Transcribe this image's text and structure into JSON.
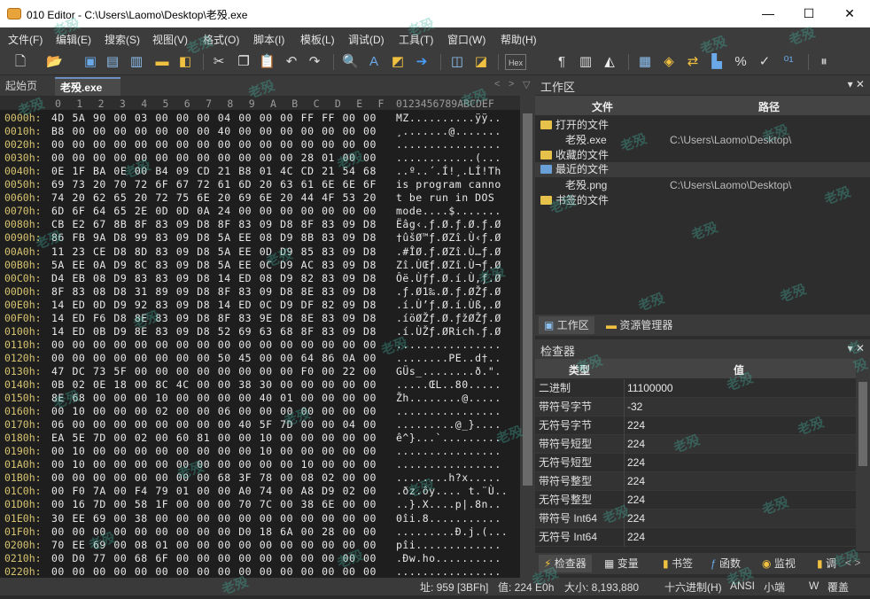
{
  "window": {
    "title": "010 Editor - C:\\Users\\Laomo\\Desktop\\老殁.exe",
    "minimize": "—",
    "maximize": "☐",
    "close": "✕"
  },
  "menu": [
    "文件(F)",
    "编辑(E)",
    "搜索(S)",
    "视图(V)",
    "格式(O)",
    "脚本(I)",
    "模板(L)",
    "调试(D)",
    "工具(T)",
    "窗口(W)",
    "帮助(H)"
  ],
  "tabs": {
    "start": "起始页",
    "file": "老殁.exe",
    "close": "✕"
  },
  "hex": {
    "columns": [
      "0",
      "1",
      "2",
      "3",
      "4",
      "5",
      "6",
      "7",
      "8",
      "9",
      "A",
      "B",
      "C",
      "D",
      "E",
      "F"
    ],
    "ascii_header": "0123456789ABCDEF",
    "rows": [
      {
        "addr": "0000h:",
        "bytes": "4D 5A 90 00 03 00 00 00 04 00 00 00 FF FF 00 00",
        "ascii": "MZ..........ÿÿ.."
      },
      {
        "addr": "0010h:",
        "bytes": "B8 00 00 00 00 00 00 00 40 00 00 00 00 00 00 00",
        "ascii": "¸.......@......."
      },
      {
        "addr": "0020h:",
        "bytes": "00 00 00 00 00 00 00 00 00 00 00 00 00 00 00 00",
        "ascii": "................"
      },
      {
        "addr": "0030h:",
        "bytes": "00 00 00 00 00 00 00 00 00 00 00 00 28 01 00 00",
        "ascii": "............(..."
      },
      {
        "addr": "0040h:",
        "bytes": "0E 1F BA 0E 00 B4 09 CD 21 B8 01 4C CD 21 54 68",
        "ascii": "..º..´.Í!¸.LÍ!Th"
      },
      {
        "addr": "0050h:",
        "bytes": "69 73 20 70 72 6F 67 72 61 6D 20 63 61 6E 6E 6F",
        "ascii": "is program canno"
      },
      {
        "addr": "0060h:",
        "bytes": "74 20 62 65 20 72 75 6E 20 69 6E 20 44 4F 53 20",
        "ascii": "t be run in DOS "
      },
      {
        "addr": "0070h:",
        "bytes": "6D 6F 64 65 2E 0D 0D 0A 24 00 00 00 00 00 00 00",
        "ascii": "mode....$......."
      },
      {
        "addr": "0080h:",
        "bytes": "CB E2 67 8B 8F 83 09 D8 8F 83 09 D8 8F 83 09 D8",
        "ascii": "Ëâg‹.ƒ.Ø.ƒ.Ø.ƒ.Ø"
      },
      {
        "addr": "0090h:",
        "bytes": "86 FB 9A D8 99 83 09 D8 5A EE 08 D9 8B 83 09 D8",
        "ascii": "†ûšØ™ƒ.ØZî.Ù‹ƒ.Ø"
      },
      {
        "addr": "00A0h:",
        "bytes": "11 23 CE D8 8D 83 09 D8 5A EE 0D D9 85 83 09 D8",
        "ascii": ".#ÎØ.ƒ.ØZî.Ù…ƒ.Ø"
      },
      {
        "addr": "00B0h:",
        "bytes": "5A EE 0A D9 8C 83 09 D8 5A EE 0C D9 AC 83 09 D8",
        "ascii": "Zî.ÙŒƒ.ØZî.Ù¬ƒ.Ø"
      },
      {
        "addr": "00C0h:",
        "bytes": "D4 EB 08 D9 83 83 09 D8 14 ED 08 D9 82 83 09 D8",
        "ascii": "Ôë.Ùƒƒ.Ø.í.Ù‚ƒ.Ø"
      },
      {
        "addr": "00D0h:",
        "bytes": "8F 83 08 D8 31 89 09 D8 8F 83 09 D8 8E 83 09 D8",
        "ascii": ".ƒ.Ø1‰.Ø.ƒ.ØŽƒ.Ø"
      },
      {
        "addr": "00E0h:",
        "bytes": "14 ED 0D D9 92 83 09 D8 14 ED 0C D9 DF 82 09 D8",
        "ascii": ".í.Ù’ƒ.Ø.í.Ùß‚.Ø"
      },
      {
        "addr": "00F0h:",
        "bytes": "14 ED F6 D8 8E 83 09 D8 8F 83 9E D8 8E 83 09 D8",
        "ascii": ".íöØŽƒ.Ø.ƒžØŽƒ.Ø"
      },
      {
        "addr": "0100h:",
        "bytes": "14 ED 0B D9 8E 83 09 D8 52 69 63 68 8F 83 09 D8",
        "ascii": ".í.ÙŽƒ.ØRich.ƒ.Ø"
      },
      {
        "addr": "0110h:",
        "bytes": "00 00 00 00 00 00 00 00 00 00 00 00 00 00 00 00",
        "ascii": "................"
      },
      {
        "addr": "0120h:",
        "bytes": "00 00 00 00 00 00 00 00 50 45 00 00 64 86 0A 00",
        "ascii": "........PE..d†.."
      },
      {
        "addr": "0130h:",
        "bytes": "47 DC 73 5F 00 00 00 00 00 00 00 00 F0 00 22 00",
        "ascii": "GÜs_........ð.\"."
      },
      {
        "addr": "0140h:",
        "bytes": "0B 02 0E 18 00 8C 4C 00 00 38 30 00 00 00 00 00",
        "ascii": ".....ŒL..80....."
      },
      {
        "addr": "0150h:",
        "bytes": "8E 68 00 00 00 10 00 00 00 00 40 01 00 00 00 00",
        "ascii": "Žh........@....."
      },
      {
        "addr": "0160h:",
        "bytes": "00 10 00 00 00 02 00 00 06 00 00 00 00 00 00 00",
        "ascii": "................"
      },
      {
        "addr": "0170h:",
        "bytes": "06 00 00 00 00 00 00 00 00 40 5F 7D 00 00 04 00",
        "ascii": ".........@_}...."
      },
      {
        "addr": "0180h:",
        "bytes": "EA 5E 7D 00 02 00 60 81 00 00 10 00 00 00 00 00",
        "ascii": "ê^}...`........."
      },
      {
        "addr": "0190h:",
        "bytes": "00 10 00 00 00 00 00 00 00 00 10 00 00 00 00 00",
        "ascii": "................"
      },
      {
        "addr": "01A0h:",
        "bytes": "00 10 00 00 00 00 00 00 00 00 00 00 10 00 00 00",
        "ascii": "................"
      },
      {
        "addr": "01B0h:",
        "bytes": "00 00 00 00 00 00 00 00 68 3F 78 00 08 02 00 00",
        "ascii": "........h?x....."
      },
      {
        "addr": "01C0h:",
        "bytes": "00 F0 7A 00 F4 79 01 00 00 A0 74 00 A8 D9 02 00",
        "ascii": ".ðz.ôy.... t.¨Ù.."
      },
      {
        "addr": "01D0h:",
        "bytes": "00 16 7D 00 58 1F 00 00 00 70 7C 00 38 6E 00 00",
        "ascii": "..}.X....p|.8n.."
      },
      {
        "addr": "01E0h:",
        "bytes": "30 EE 69 00 38 00 00 00 00 00 00 00 00 00 00 00",
        "ascii": "0îi.8..........."
      },
      {
        "addr": "01F0h:",
        "bytes": "00 00 00 00 00 00 00 00 00 D0 18 6A 00 28 00 00",
        "ascii": ".........Ð.j.(..."
      },
      {
        "addr": "0200h:",
        "bytes": "70 EE 69 00 08 01 00 00 00 00 00 00 00 00 00 00",
        "ascii": "pîi............."
      },
      {
        "addr": "0210h:",
        "bytes": "00 D0 77 00 68 6F 00 00 00 00 00 00 00 00 00 00",
        "ascii": ".Ðw.ho.........."
      },
      {
        "addr": "0220h:",
        "bytes": "00 00 00 00 00 00 00 00 00 00 00 00 00 00 00 00",
        "ascii": "................"
      }
    ]
  },
  "workspace": {
    "title": "工作区",
    "col_file": "文件",
    "col_path": "路径",
    "items": [
      {
        "label": "打开的文件",
        "path": ""
      },
      {
        "label": "老殁.exe",
        "path": "C:\\Users\\Laomo\\Desktop\\"
      },
      {
        "label": "收藏的文件",
        "path": ""
      },
      {
        "label": "最近的文件",
        "path": ""
      },
      {
        "label": "老殁.png",
        "path": "C:\\Users\\Laomo\\Desktop\\"
      },
      {
        "label": "书签的文件",
        "path": ""
      }
    ],
    "tabs": [
      "工作区",
      "资源管理器"
    ]
  },
  "inspector": {
    "title": "检查器",
    "col_type": "类型",
    "col_value": "值",
    "rows": [
      {
        "k": "二进制",
        "v": "11100000"
      },
      {
        "k": "带符号字节",
        "v": "-32"
      },
      {
        "k": "无符号字节",
        "v": "224"
      },
      {
        "k": "带符号短型",
        "v": "224"
      },
      {
        "k": "无符号短型",
        "v": "224"
      },
      {
        "k": "带符号整型",
        "v": "224"
      },
      {
        "k": "无符号整型",
        "v": "224"
      },
      {
        "k": "带符号 Int64",
        "v": "224"
      },
      {
        "k": "无符号 Int64",
        "v": "224"
      }
    ],
    "tabs": [
      "检查器",
      "变量",
      "书签",
      "函数",
      "监视",
      "调"
    ]
  },
  "status": {
    "addr": "址: 959 [3BFh]",
    "val": "值: 224 E0h",
    "size": "大小: 8,193,880",
    "mode": "十六进制(H)",
    "enc": "ANSI",
    "endian": "小端",
    "w": "W",
    "overwrite": "覆盖"
  },
  "watermark": "老殁"
}
